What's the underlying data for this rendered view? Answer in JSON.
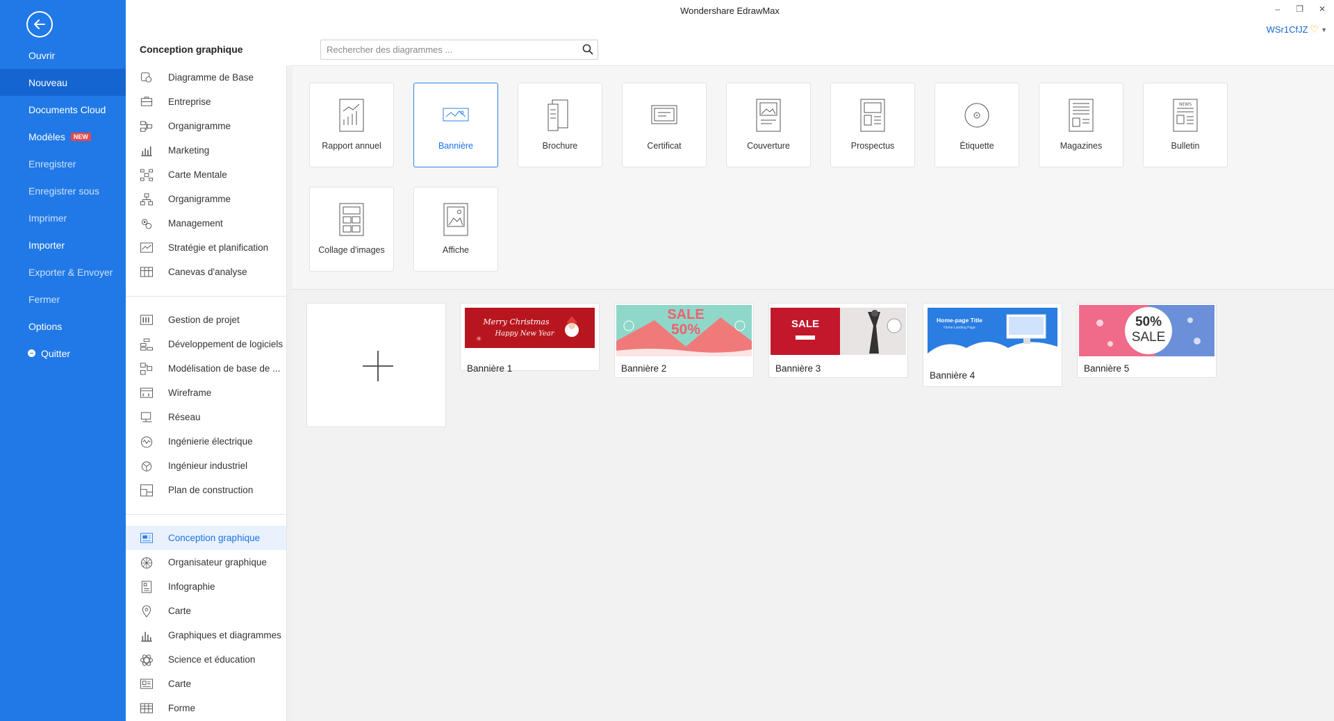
{
  "app": {
    "title": "Wondershare EdrawMax",
    "user": "WSr1CfJZ",
    "window_controls": [
      "–",
      "❐",
      "✕"
    ]
  },
  "sidebar": {
    "items": [
      {
        "label": "Ouvrir",
        "style": "normal"
      },
      {
        "label": "Nouveau",
        "style": "active"
      },
      {
        "label": "Documents Cloud",
        "style": "normal"
      },
      {
        "label": "Modèles",
        "style": "normal",
        "badge": "NEW"
      },
      {
        "label": "Enregistrer",
        "style": "dim"
      },
      {
        "label": "Enregistrer sous",
        "style": "dim"
      },
      {
        "label": "Imprimer",
        "style": "dim"
      },
      {
        "label": "Importer",
        "style": "normal"
      },
      {
        "label": "Exporter & Envoyer",
        "style": "dim"
      },
      {
        "label": "Fermer",
        "style": "dim"
      },
      {
        "label": "Options",
        "style": "normal"
      },
      {
        "label": "Quitter",
        "style": "normal"
      }
    ]
  },
  "category_panel": {
    "header": "Conception graphique",
    "groups": [
      [
        "Diagramme de Base",
        "Entreprise",
        "Organigramme",
        "Marketing",
        "Carte Mentale",
        "Organigramme",
        "Management",
        "Stratégie et planification",
        "Canevas d'analyse"
      ],
      [
        "Gestion de projet",
        "Développement de logiciels",
        "Modélisation de base de ...",
        "Wireframe",
        "Réseau",
        "Ingénierie électrique",
        "Ingénieur industriel",
        "Plan de construction"
      ],
      [
        "Conception graphique",
        "Organisateur graphique",
        "Infographie",
        "Carte",
        "Graphiques et diagrammes",
        "Science et éducation",
        "Carte",
        "Forme"
      ]
    ],
    "active": "Conception graphique"
  },
  "search": {
    "placeholder": "Rechercher des diagrammes ..."
  },
  "templates": {
    "types": [
      "Rapport annuel",
      "Bannière",
      "Brochure",
      "Certificat",
      "Couverture",
      "Prospectus",
      "Étiquette",
      "Magazines",
      "Bulletin",
      "Collage d'images",
      "Affiche"
    ],
    "selected": "Bannière"
  },
  "banners": {
    "items": [
      {
        "label": "Bannière 1",
        "art_text": [
          "Merry Christmas",
          "Happy New Year"
        ]
      },
      {
        "label": "Bannière 2",
        "art_text": [
          "SALE",
          "50%"
        ]
      },
      {
        "label": "Bannière 3",
        "art_text": [
          "SALE"
        ]
      },
      {
        "label": "Bannière 4",
        "art_text": [
          "Home-page Title",
          "Home Landing Page"
        ]
      },
      {
        "label": "Bannière 5",
        "art_text": [
          "50%",
          "SALE"
        ]
      }
    ]
  },
  "colors": {
    "sidebar_bg": "#2079e6",
    "accent": "#1a73e8",
    "badge": "#e5484d"
  }
}
